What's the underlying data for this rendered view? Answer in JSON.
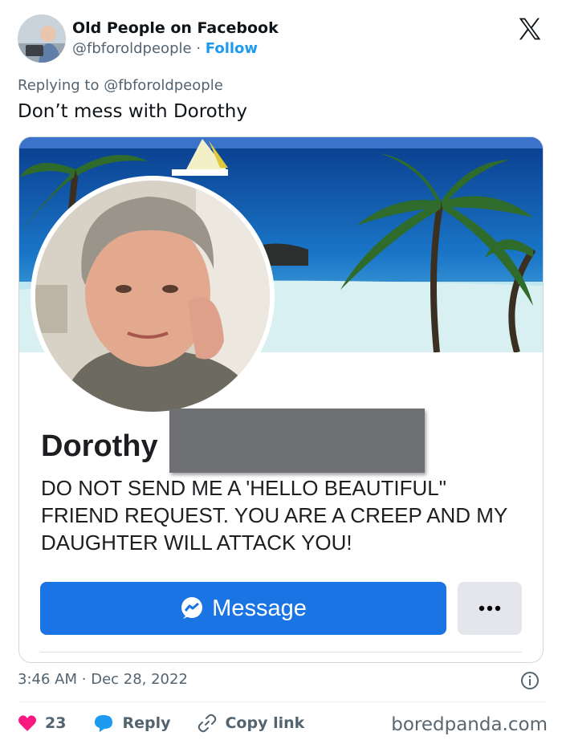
{
  "tweet": {
    "author_name": "Old People on Facebook",
    "author_handle": "@fbforoldpeople",
    "separator": "·",
    "follow_label": "Follow",
    "replying_to": "Replying to @fbforoldpeople",
    "text": "Don’t mess with Dorothy",
    "time": "3:46 AM",
    "date": "Dec 28, 2022",
    "likes": "23",
    "reply_label": "Reply",
    "copy_link_label": "Copy link"
  },
  "embedded_profile": {
    "name": "Dorothy",
    "bio_lines": [
      "DO NOT SEND ME A 'HELLO BEAUTIFUL\"",
      "FRIEND REQUEST. YOU ARE A CREEP AND MY",
      "DAUGHTER WILL ATTACK YOU!"
    ],
    "message_label": "Message",
    "more_label": "..."
  },
  "watermark": "boredpanda.com",
  "icons": {
    "platform": "x-logo-icon",
    "like": "heart-icon",
    "reply": "reply-bubble-icon",
    "copy": "link-icon",
    "info": "info-icon",
    "messenger": "messenger-icon"
  },
  "colors": {
    "follow": "#1d9bf0",
    "message_button": "#1b74e4",
    "like": "#f91880",
    "reply_icon": "#1d9bf0"
  }
}
